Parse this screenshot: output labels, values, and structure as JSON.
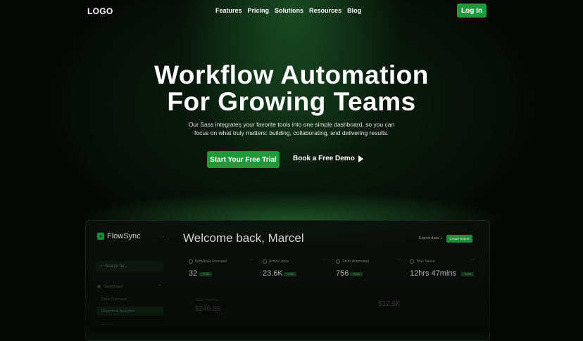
{
  "nav": {
    "logo": "LOGO",
    "links": [
      "Features",
      "Pricing",
      "Solutions",
      "Resources",
      "Blog"
    ],
    "login_label": "Log In"
  },
  "hero": {
    "title_line1": "Workflow Automation",
    "title_line2": "For Growing Teams",
    "subtitle": "Our Sass integrates your favorite tools into one simple dashboard, so you can focus on what truly matters: building, collaborating, and delivering results.",
    "primary_cta": "Start Your Free Trial",
    "secondary_cta": "Book a Free Demo"
  },
  "dashboard": {
    "brand": "FlowSync",
    "brand_icon": "»",
    "search_placeholder": "Search for...",
    "sidebar_section": "Dashboard",
    "sidebar_items": [
      "Data Overview",
      "Reports & Analytics"
    ],
    "welcome": "Welcome back, Marcel",
    "export_label": "Export data ⇣",
    "create_label": "Create Report",
    "stats": [
      {
        "label": "Workflows Executed",
        "value": "32",
        "badge": "+0.0%"
      },
      {
        "label": "Active Users",
        "value": "23.6K",
        "badge": "+0.0%"
      },
      {
        "label": "Tasks Automated",
        "value": "756",
        "badge": "+0.0%"
      },
      {
        "label": "Time Saved",
        "value": "12hrs 47mins",
        "badge": "+0.0%"
      }
    ],
    "lower": {
      "left_label": "Total revenue",
      "left_value": "$240.8K",
      "right_value": "$12.6K"
    }
  }
}
